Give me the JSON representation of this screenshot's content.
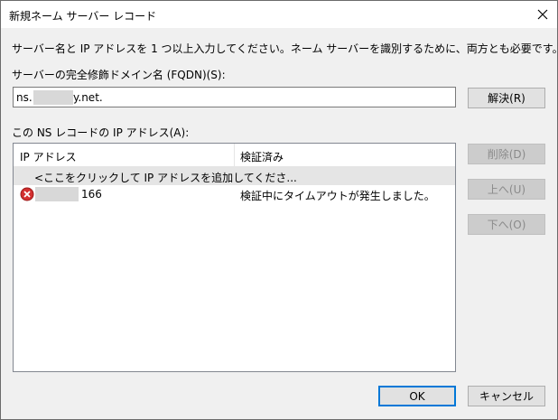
{
  "window": {
    "title": "新規ネーム サーバー レコード"
  },
  "instructions": "サーバー名と IP アドレスを 1 つ以上入力してください。ネーム サーバーを識別するために、両方とも必要です。",
  "fqdn": {
    "label": "サーバーの完全修飾ドメイン名 (FQDN)(S):",
    "value_prefix": "ns.",
    "value_suffix": "y.net.",
    "resolve_label": "解決(R)"
  },
  "ip_list": {
    "label": "この NS レコードの IP アドレス(A):",
    "columns": [
      "IP アドレス",
      "検証済み"
    ],
    "add_row": "<ここをクリックして IP アドレスを追加してくださ...",
    "rows": [
      {
        "ip_suffix": "166",
        "status": "検証中にタイムアウトが発生しました。",
        "icon": "error-icon"
      }
    ]
  },
  "side_buttons": {
    "delete": "削除(D)",
    "up": "上へ(U)",
    "down": "下へ(O)"
  },
  "footer": {
    "ok": "OK",
    "cancel": "キャンセル"
  },
  "colors": {
    "accent": "#0078d7",
    "error": "#d32f2f"
  }
}
